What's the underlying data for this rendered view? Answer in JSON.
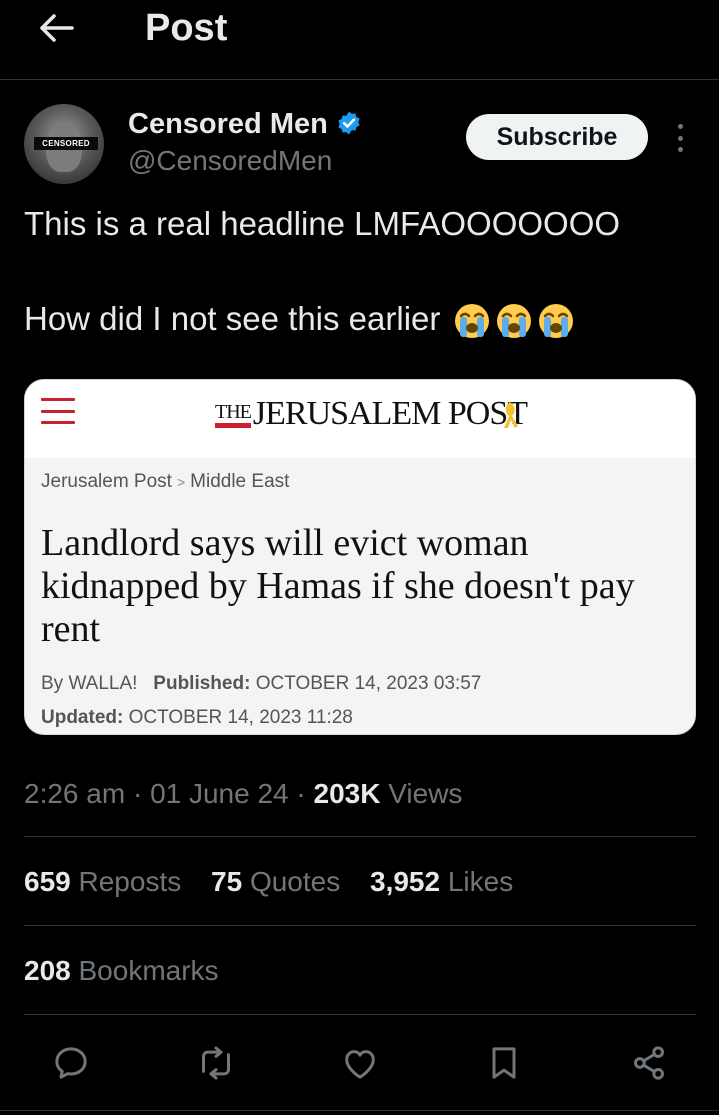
{
  "header": {
    "title": "Post"
  },
  "author": {
    "name": "Censored Men",
    "handle": "@CensoredMen",
    "avatar_label": "CENSORED",
    "verified_color": "#1d9bf0",
    "subscribe_label": "Subscribe"
  },
  "tweet": {
    "line1": "This is a real headline LMFAOOOOOOO",
    "line2": "How did I not see this earlier",
    "emojis": [
      "loudly-crying-face",
      "loudly-crying-face",
      "loudly-crying-face"
    ]
  },
  "card": {
    "logo_the": "THE",
    "logo_main": "JERUSALEM POST",
    "breadcrumb": [
      "Jerusalem Post",
      "Middle East"
    ],
    "breadcrumb_sep": ">",
    "title": "Landlord says will evict woman kidnapped by Hamas if she doesn't pay rent",
    "by_label": "By WALLA!",
    "published_label": "Published:",
    "published_value": "OCTOBER 14, 2023 03:57",
    "updated_label": "Updated:",
    "updated_value": "OCTOBER 14, 2023 11:28",
    "accent_color": "#c8202f"
  },
  "meta": {
    "time": "2:26 am",
    "date": "01 June 24",
    "views_count": "203K",
    "views_label": "Views"
  },
  "stats": {
    "reposts_count": "659",
    "reposts_label": "Reposts",
    "quotes_count": "75",
    "quotes_label": "Quotes",
    "likes_count": "3,952",
    "likes_label": "Likes",
    "bookmarks_count": "208",
    "bookmarks_label": "Bookmarks"
  },
  "actions": [
    "reply-icon",
    "repost-icon",
    "like-icon",
    "bookmark-icon",
    "share-icon"
  ]
}
